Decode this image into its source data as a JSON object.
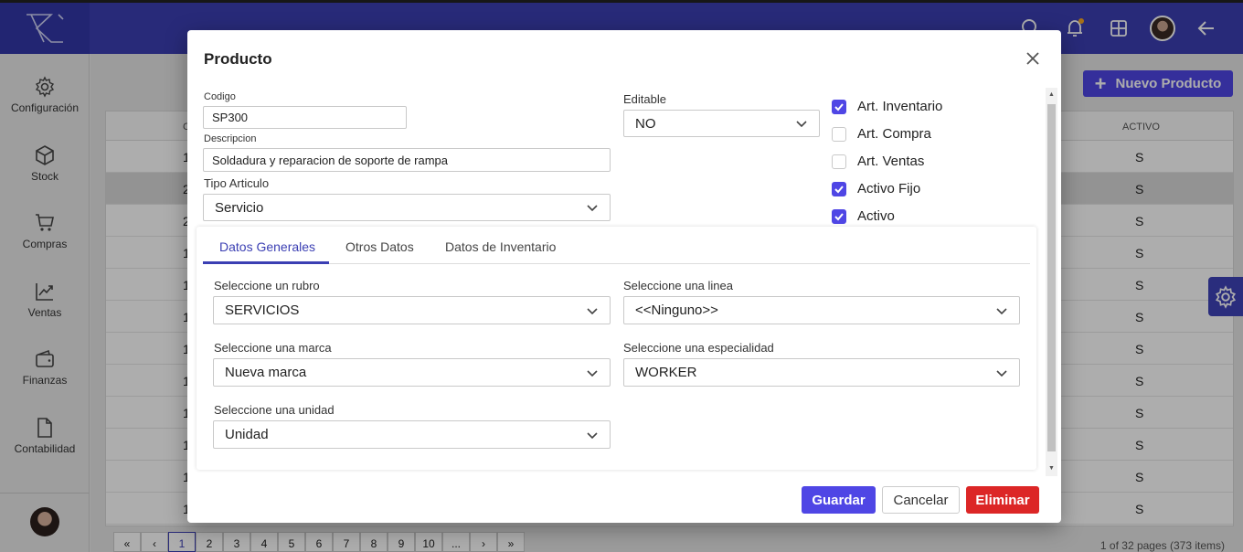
{
  "header": {
    "icons": [
      "logo-icon",
      "search-icon",
      "bell-icon",
      "grid-icon",
      "avatar",
      "arrow-left-icon"
    ],
    "accent": "#3b3fb3"
  },
  "sidebar": {
    "items": [
      {
        "label": "Configuración",
        "icon": "gear-icon"
      },
      {
        "label": "Stock",
        "icon": "box-icon"
      },
      {
        "label": "Compras",
        "icon": "cart-icon"
      },
      {
        "label": "Ventas",
        "icon": "trend-icon"
      },
      {
        "label": "Finanzas",
        "icon": "wallet-icon"
      },
      {
        "label": "Contabilidad",
        "icon": "document-icon"
      }
    ]
  },
  "list": {
    "new_button": "Nuevo Producto",
    "header_col1": "C",
    "header_activo": "ACTIVO",
    "rows": [
      {
        "c1": "1",
        "activo": "S"
      },
      {
        "c1": "2",
        "activo": "S"
      },
      {
        "c1": "2",
        "activo": "S"
      },
      {
        "c1": "1",
        "activo": "S"
      },
      {
        "c1": "1",
        "activo": "S"
      },
      {
        "c1": "1",
        "activo": "S"
      },
      {
        "c1": "1",
        "activo": "S"
      },
      {
        "c1": "1",
        "activo": "S"
      },
      {
        "c1": "1",
        "activo": "S"
      },
      {
        "c1": "1",
        "activo": "S"
      },
      {
        "c1": "1",
        "activo": "S"
      },
      {
        "c1": "1",
        "activo": "S"
      }
    ],
    "pager": [
      "«",
      "‹",
      "1",
      "2",
      "3",
      "4",
      "5",
      "6",
      "7",
      "8",
      "9",
      "10",
      "...",
      "›",
      "»"
    ],
    "pager_info": "1 of 32 pages (373 items)"
  },
  "modal": {
    "title": "Producto",
    "codigo_label": "Codigo",
    "codigo_value": "SP300",
    "descripcion_label": "Descripcion",
    "descripcion_value": "Soldadura y reparacion de soporte de rampa",
    "tipo_label": "Tipo Articulo",
    "tipo_value": "Servicio",
    "editable_label": "Editable",
    "editable_value": "NO",
    "checks": [
      {
        "label": "Art. Inventario",
        "checked": true
      },
      {
        "label": "Art. Compra",
        "checked": false
      },
      {
        "label": "Art. Ventas",
        "checked": false
      },
      {
        "label": "Activo Fijo",
        "checked": true
      },
      {
        "label": "Activo",
        "checked": true
      }
    ],
    "tabs": [
      "Datos Generales",
      "Otros Datos",
      "Datos de Inventario"
    ],
    "rubro_label": "Seleccione un rubro",
    "rubro_value": "SERVICIOS",
    "linea_label": "Seleccione una linea",
    "linea_value": "<<Ninguno>>",
    "marca_label": "Seleccione una marca",
    "marca_value": "Nueva marca",
    "especialidad_label": "Seleccione una especialidad",
    "especialidad_value": "WORKER",
    "unidad_label": "Seleccione una unidad",
    "unidad_value": "Unidad",
    "save_label": "Guardar",
    "cancel_label": "Cancelar",
    "delete_label": "Eliminar"
  },
  "colors": {
    "primary": "#4f46e5",
    "danger": "#dc2626"
  }
}
